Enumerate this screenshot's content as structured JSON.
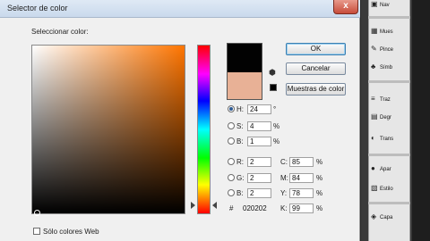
{
  "dialog": {
    "title": "Selector de color",
    "select_label": "Seleccionar color:",
    "close_glyph": "x"
  },
  "buttons": {
    "ok": "OK",
    "cancel": "Cancelar",
    "swatches": "Muestras de color"
  },
  "colors": {
    "new_color": "#020202",
    "old_color": "#e8b196",
    "web_color": "#000000"
  },
  "hsb": [
    {
      "label": "H:",
      "value": "24",
      "unit": "°",
      "selected": true
    },
    {
      "label": "S:",
      "value": "4",
      "unit": "%",
      "selected": false
    },
    {
      "label": "B:",
      "value": "1",
      "unit": "%",
      "selected": false
    }
  ],
  "rgb": [
    {
      "label": "R:",
      "value": "2"
    },
    {
      "label": "G:",
      "value": "2"
    },
    {
      "label": "B:",
      "value": "2"
    }
  ],
  "cmyk": [
    {
      "label": "C:",
      "value": "85",
      "unit": "%"
    },
    {
      "label": "M:",
      "value": "84",
      "unit": "%"
    },
    {
      "label": "Y:",
      "value": "78",
      "unit": "%"
    },
    {
      "label": "K:",
      "value": "99",
      "unit": "%"
    }
  ],
  "hex": {
    "label": "#",
    "value": "020202"
  },
  "web_only_label": "Sólo colores Web",
  "side_panel": {
    "items": [
      {
        "label": "Nav",
        "icon": "navigator-icon"
      },
      {
        "label": "Mues",
        "icon": "swatches-icon"
      },
      {
        "label": "Pince",
        "icon": "brush-icon"
      },
      {
        "label": "Símb",
        "icon": "symbol-icon"
      },
      {
        "label": "Traz",
        "icon": "stroke-icon"
      },
      {
        "label": "Degr",
        "icon": "gradient-icon"
      },
      {
        "label": "Trans",
        "icon": "transparency-icon"
      },
      {
        "label": "Apar",
        "icon": "appearance-icon"
      },
      {
        "label": "Estilo",
        "icon": "styles-icon"
      },
      {
        "label": "Capa",
        "icon": "layers-icon"
      }
    ]
  }
}
